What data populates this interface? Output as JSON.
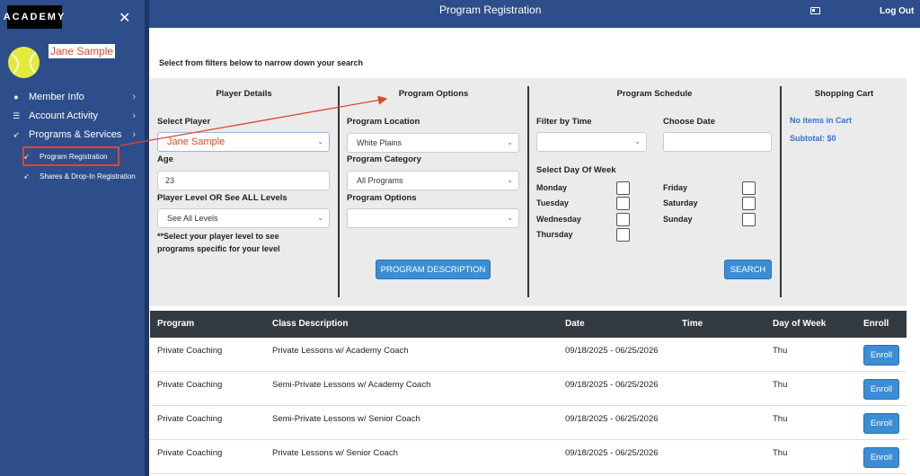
{
  "sidebar": {
    "logo_text": "ACADEMY",
    "close_glyph": "✕",
    "user_name": "Jane Sample",
    "items": [
      {
        "label": "Member Info",
        "icon": "user-icon",
        "glyph": "👤"
      },
      {
        "label": "Account Activity",
        "icon": "list-icon",
        "glyph": "☰"
      },
      {
        "label": "Programs & Services",
        "icon": "tennis-icon",
        "glyph": "✈"
      }
    ],
    "sub_items": [
      {
        "label": "Program Registration",
        "icon": "tennis-icon"
      },
      {
        "label": "Shares & Drop-In Registration",
        "icon": "tennis-icon"
      }
    ]
  },
  "header": {
    "title": "Program Registration",
    "logout_label": "Log Out"
  },
  "intro": "Select from filters below to narrow down your search",
  "filters": {
    "player_details": {
      "heading": "Player Details",
      "select_player_label": "Select Player",
      "select_player_value": "Jane Sample",
      "age_label": "Age",
      "age_value": "23",
      "level_label": "Player Level OR See ALL Levels",
      "level_value": "See All Levels",
      "note_line1": "**Select your player level to see",
      "note_line2": "programs specific for your level"
    },
    "program_options": {
      "heading": "Program Options",
      "location_label": "Program Location",
      "location_value": "White Plains",
      "category_label": "Program Category",
      "category_value": "All Programs",
      "options_label": "Program Options",
      "options_value": "",
      "description_button": "PROGRAM DESCRIPTION"
    },
    "program_schedule": {
      "heading": "Program Schedule",
      "time_label": "Filter by Time",
      "date_label": "Choose Date",
      "dow_label": "Select Day Of Week",
      "days_left": [
        "Monday",
        "Tuesday",
        "Wednesday",
        "Thursday"
      ],
      "days_right": [
        "Friday",
        "Saturday",
        "Sunday"
      ],
      "search_button": "SEARCH"
    },
    "cart": {
      "heading": "Shopping Cart",
      "empty_text": "No items in Cart",
      "subtotal_text": "Subtotal: $0"
    }
  },
  "table": {
    "headers": [
      "Program",
      "Class Description",
      "Date",
      "Time",
      "Day of Week",
      "Enroll"
    ],
    "rows": [
      {
        "program": "Private Coaching",
        "description": "Private Lessons w/ Academy Coach",
        "date": "09/18/2025 - 06/25/2026",
        "time": "",
        "day": "Thu",
        "enroll": "Enroll"
      },
      {
        "program": "Private Coaching",
        "description": "Semi-Private Lessons w/ Academy Coach",
        "date": "09/18/2025 - 06/25/2026",
        "time": "",
        "day": "Thu",
        "enroll": "Enroll"
      },
      {
        "program": "Private Coaching",
        "description": "Semi-Private Lessons w/ Senior Coach",
        "date": "09/18/2025 - 06/25/2026",
        "time": "",
        "day": "Thu",
        "enroll": "Enroll"
      },
      {
        "program": "Private Coaching",
        "description": "Private Lessons w/ Senior Coach",
        "date": "09/18/2025 - 06/25/2026",
        "time": "",
        "day": "Thu",
        "enroll": "Enroll"
      }
    ]
  },
  "colors": {
    "sidebar_bg": "#2d4e8a",
    "accent_blue": "#3b8dd6",
    "annotation_red": "#e0462d",
    "table_header_bg": "#333a40"
  }
}
